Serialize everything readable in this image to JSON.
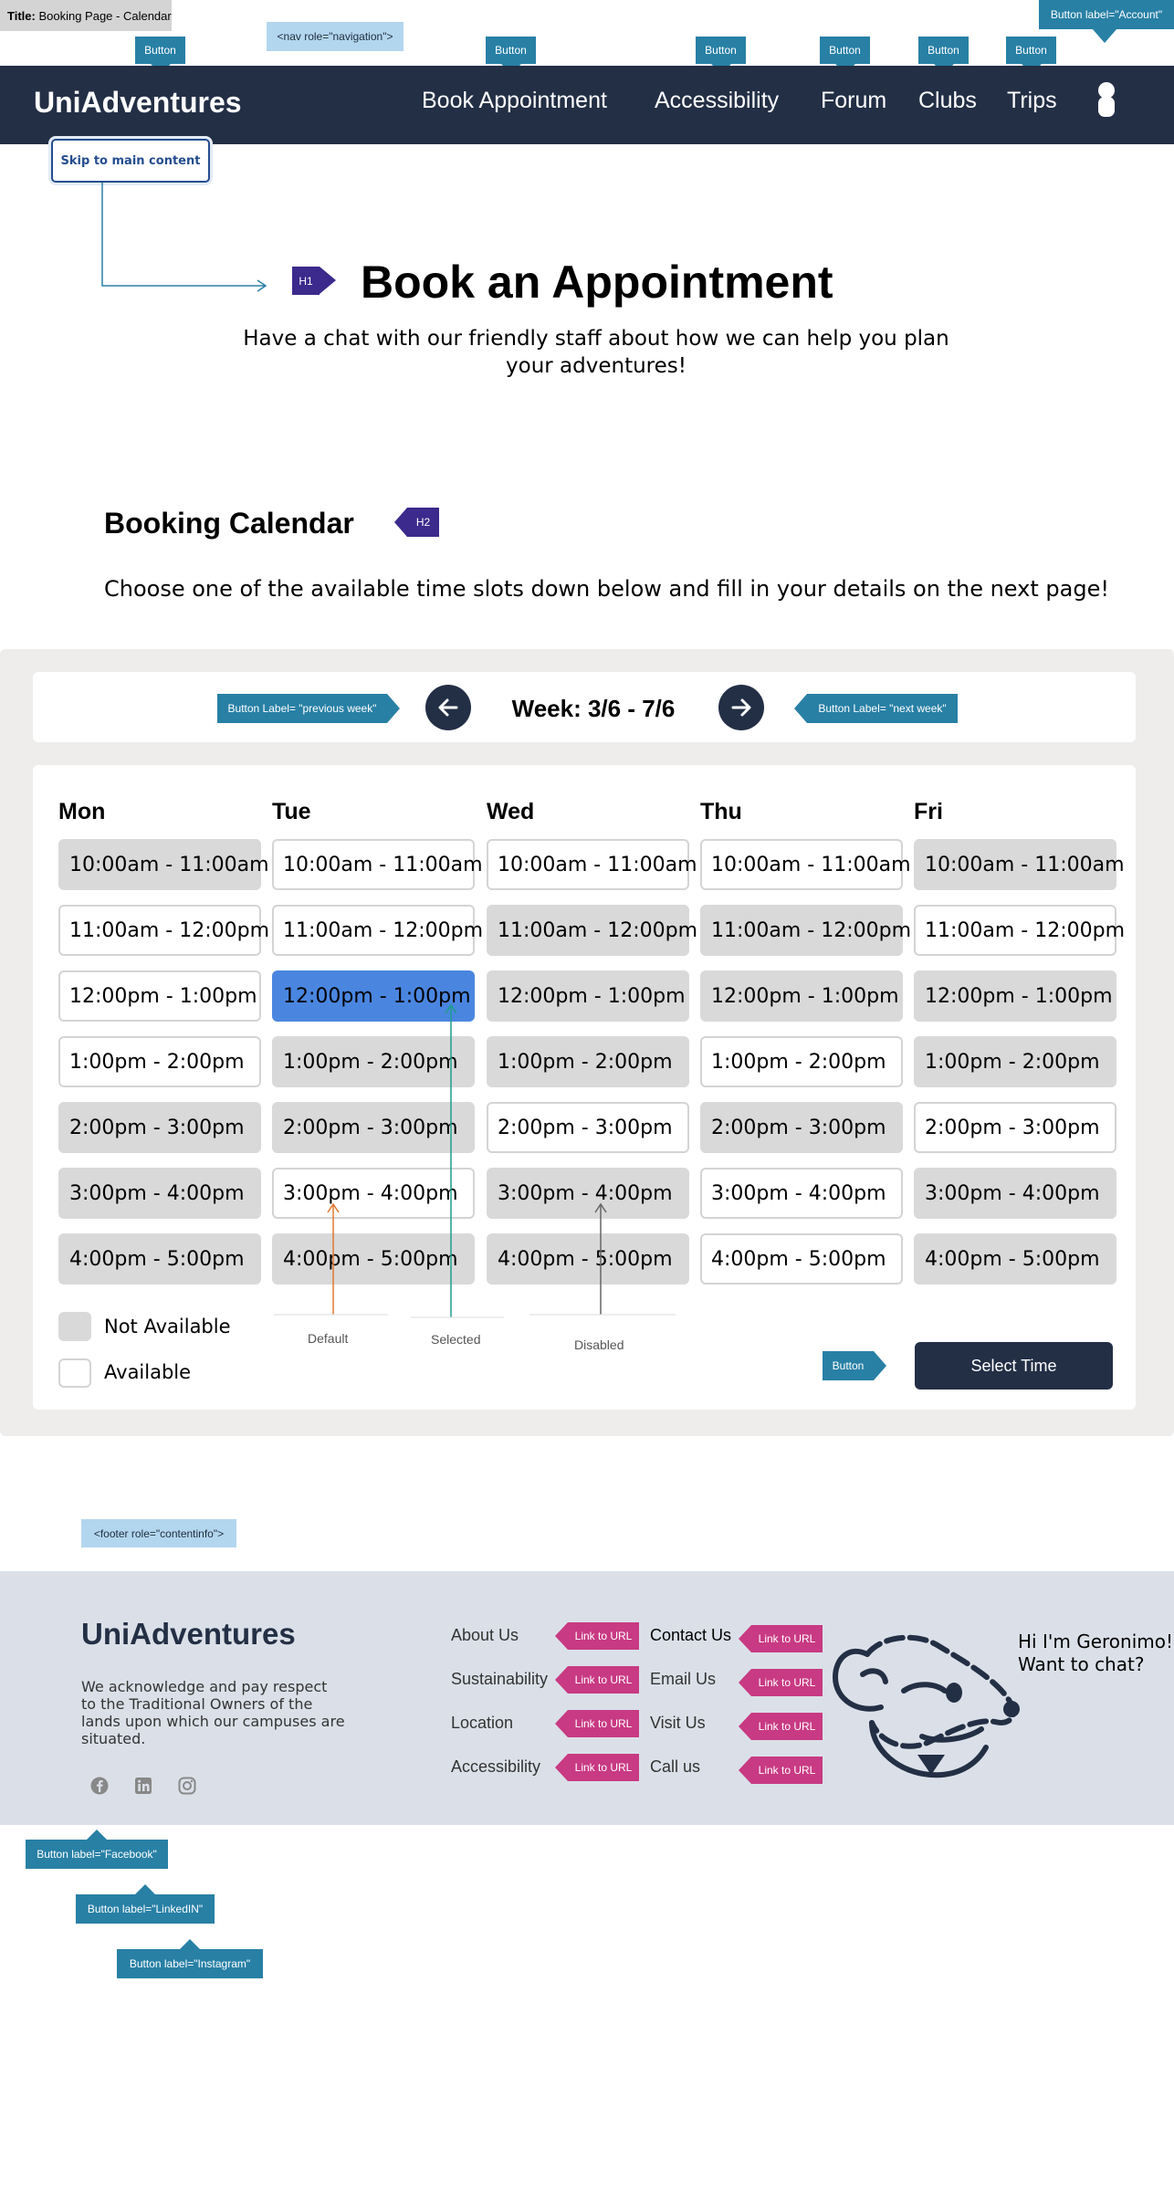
{
  "page_title_label": "Title:",
  "page_title_value": "Booking Page - Calendar",
  "annotations": {
    "button": "Button",
    "account_button": "Button label=\"Account\"",
    "nav_role": "<nav role=\"navigation\">",
    "h1": "H1",
    "h2": "H2",
    "prev_week": "Button Label= \"previous week\"",
    "next_week": "Button Label= \"next week\"",
    "footer_role": "<footer role=\"contentinfo\">",
    "link_to_url": "Link to URL",
    "facebook": "Button label=\"Facebook\"",
    "linkedin": "Button label=\"LinkedIN\"",
    "instagram": "Button label=\"Instagram\""
  },
  "header": {
    "brand": "UniAdventures",
    "nav": [
      "Book Appointment",
      "Accessibility",
      "Forum",
      "Clubs",
      "Trips"
    ],
    "background": "#232f45"
  },
  "skip_link": "Skip to main content",
  "hero": {
    "title": "Book an Appointment",
    "intro": "Have a chat with our friendly staff about how we can help you plan your adventures!"
  },
  "calendar": {
    "heading": "Booking Calendar",
    "instructions": "Choose one of the available time slots down below and fill in your details on the next page!",
    "week_label": "Week: 3/6 - 7/6",
    "days": [
      {
        "name": "Mon",
        "slots": [
          {
            "time": "10:00am - 11:00am",
            "state": "na"
          },
          {
            "time": "11:00am - 12:00pm",
            "state": "avail"
          },
          {
            "time": "12:00pm - 1:00pm",
            "state": "avail"
          },
          {
            "time": "1:00pm - 2:00pm",
            "state": "avail"
          },
          {
            "time": "2:00pm - 3:00pm",
            "state": "na"
          },
          {
            "time": "3:00pm - 4:00pm",
            "state": "na"
          },
          {
            "time": "4:00pm - 5:00pm",
            "state": "na"
          }
        ]
      },
      {
        "name": "Tue",
        "slots": [
          {
            "time": "10:00am - 11:00am",
            "state": "avail"
          },
          {
            "time": "11:00am - 12:00pm",
            "state": "avail"
          },
          {
            "time": "12:00pm - 1:00pm",
            "state": "sel"
          },
          {
            "time": "1:00pm - 2:00pm",
            "state": "na"
          },
          {
            "time": "2:00pm - 3:00pm",
            "state": "na"
          },
          {
            "time": "3:00pm - 4:00pm",
            "state": "avail"
          },
          {
            "time": "4:00pm - 5:00pm",
            "state": "na"
          }
        ]
      },
      {
        "name": "Wed",
        "slots": [
          {
            "time": "10:00am - 11:00am",
            "state": "avail"
          },
          {
            "time": "11:00am - 12:00pm",
            "state": "na"
          },
          {
            "time": "12:00pm - 1:00pm",
            "state": "na"
          },
          {
            "time": "1:00pm - 2:00pm",
            "state": "na"
          },
          {
            "time": "2:00pm - 3:00pm",
            "state": "avail"
          },
          {
            "time": "3:00pm - 4:00pm",
            "state": "na"
          },
          {
            "time": "4:00pm - 5:00pm",
            "state": "na"
          }
        ]
      },
      {
        "name": "Thu",
        "slots": [
          {
            "time": "10:00am - 11:00am",
            "state": "avail"
          },
          {
            "time": "11:00am - 12:00pm",
            "state": "na"
          },
          {
            "time": "12:00pm - 1:00pm",
            "state": "na"
          },
          {
            "time": "1:00pm - 2:00pm",
            "state": "avail"
          },
          {
            "time": "2:00pm - 3:00pm",
            "state": "na"
          },
          {
            "time": "3:00pm - 4:00pm",
            "state": "avail"
          },
          {
            "time": "4:00pm - 5:00pm",
            "state": "avail"
          }
        ]
      },
      {
        "name": "Fri",
        "slots": [
          {
            "time": "10:00am - 11:00am",
            "state": "na"
          },
          {
            "time": "11:00am - 12:00pm",
            "state": "avail"
          },
          {
            "time": "12:00pm - 1:00pm",
            "state": "na"
          },
          {
            "time": "1:00pm - 2:00pm",
            "state": "na"
          },
          {
            "time": "2:00pm - 3:00pm",
            "state": "avail"
          },
          {
            "time": "3:00pm - 4:00pm",
            "state": "na"
          },
          {
            "time": "4:00pm - 5:00pm",
            "state": "na"
          }
        ]
      }
    ],
    "legend": {
      "not_available": "Not Available",
      "available": "Available"
    },
    "states": {
      "default": "Default",
      "selected": "Selected",
      "disabled": "Disabled"
    },
    "select_button": "Select Time",
    "colors": {
      "selected": "#4a86e0",
      "not_available": "#d9d9d9"
    }
  },
  "footer": {
    "brand": "UniAdventures",
    "acknowledgement": "We acknowledge and pay respect to the Traditional Owners of the lands upon which our campuses are situated.",
    "links_col1": [
      "About Us",
      "Sustainability",
      "Location",
      "Accessibility"
    ],
    "links_col2": [
      "Contact Us",
      "Email Us",
      "Visit Us",
      "Call us"
    ],
    "chat": "Hi I'm Geronimo!\nWant to chat?",
    "social_icons": [
      "facebook-icon",
      "linkedin-icon",
      "instagram-icon"
    ]
  }
}
